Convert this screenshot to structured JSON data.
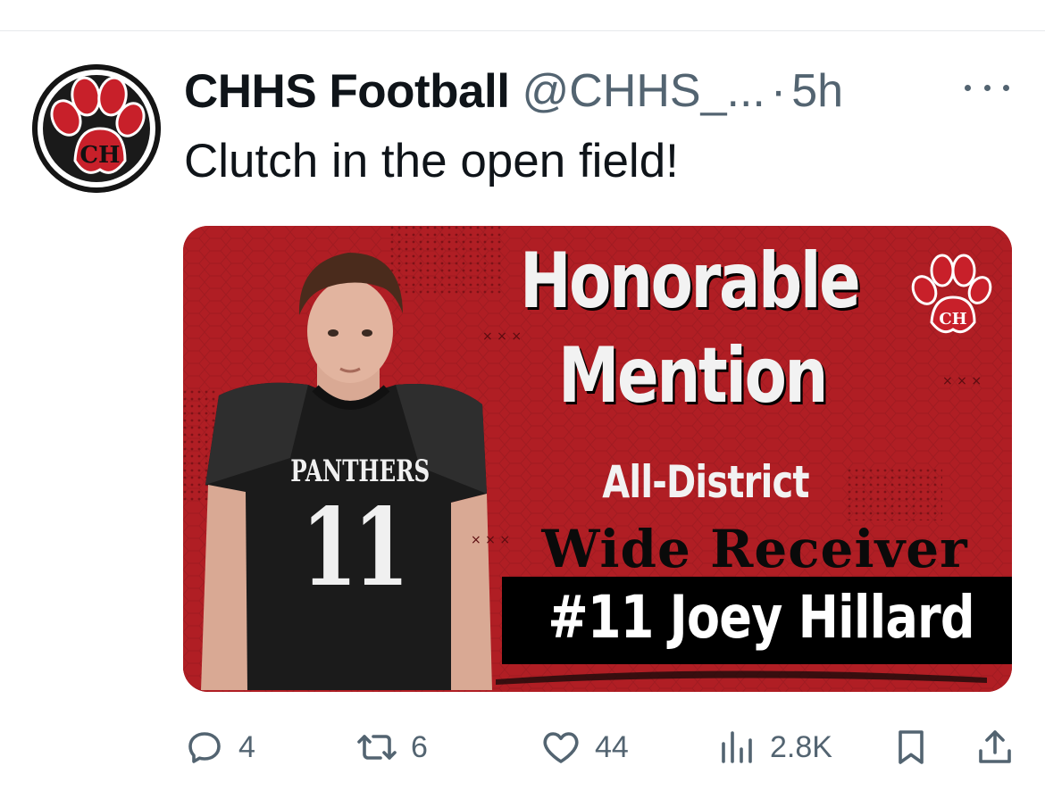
{
  "tweet": {
    "display_name": "CHHS Football",
    "handle": "@CHHS_...",
    "separator": "·",
    "time": "5h",
    "text": "Clutch in the open field!",
    "avatar_icon": "paw-logo-icon",
    "avatar_monogram": "CH",
    "more_icon": "more-dots-icon"
  },
  "media": {
    "headline_line1": "Honorable",
    "headline_line2": "Mention",
    "subtitle": "All-District",
    "position": "Wide Receiver",
    "player": "#11 Joey Hillard",
    "jersey_team": "PANTHERS",
    "jersey_number": "11",
    "logo_monogram": "CH",
    "colors": {
      "background": "#b01e24",
      "plate": "#000000",
      "text": "#f2f2f2"
    }
  },
  "actions": {
    "replies": "4",
    "retweets": "6",
    "likes": "44",
    "views": "2.8K",
    "icons": [
      "reply-icon",
      "retweet-icon",
      "like-heart-icon",
      "views-chart-icon",
      "bookmark-icon",
      "share-icon"
    ]
  }
}
